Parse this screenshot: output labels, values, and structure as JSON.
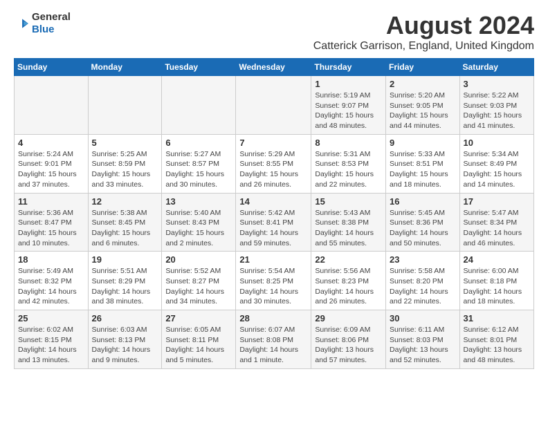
{
  "logo": {
    "text_general": "General",
    "text_blue": "Blue"
  },
  "title": "August 2024",
  "subtitle": "Catterick Garrison, England, United Kingdom",
  "weekdays": [
    "Sunday",
    "Monday",
    "Tuesday",
    "Wednesday",
    "Thursday",
    "Friday",
    "Saturday"
  ],
  "weeks": [
    [
      {
        "day": "",
        "info": ""
      },
      {
        "day": "",
        "info": ""
      },
      {
        "day": "",
        "info": ""
      },
      {
        "day": "",
        "info": ""
      },
      {
        "day": "1",
        "info": "Sunrise: 5:19 AM\nSunset: 9:07 PM\nDaylight: 15 hours\nand 48 minutes."
      },
      {
        "day": "2",
        "info": "Sunrise: 5:20 AM\nSunset: 9:05 PM\nDaylight: 15 hours\nand 44 minutes."
      },
      {
        "day": "3",
        "info": "Sunrise: 5:22 AM\nSunset: 9:03 PM\nDaylight: 15 hours\nand 41 minutes."
      }
    ],
    [
      {
        "day": "4",
        "info": "Sunrise: 5:24 AM\nSunset: 9:01 PM\nDaylight: 15 hours\nand 37 minutes."
      },
      {
        "day": "5",
        "info": "Sunrise: 5:25 AM\nSunset: 8:59 PM\nDaylight: 15 hours\nand 33 minutes."
      },
      {
        "day": "6",
        "info": "Sunrise: 5:27 AM\nSunset: 8:57 PM\nDaylight: 15 hours\nand 30 minutes."
      },
      {
        "day": "7",
        "info": "Sunrise: 5:29 AM\nSunset: 8:55 PM\nDaylight: 15 hours\nand 26 minutes."
      },
      {
        "day": "8",
        "info": "Sunrise: 5:31 AM\nSunset: 8:53 PM\nDaylight: 15 hours\nand 22 minutes."
      },
      {
        "day": "9",
        "info": "Sunrise: 5:33 AM\nSunset: 8:51 PM\nDaylight: 15 hours\nand 18 minutes."
      },
      {
        "day": "10",
        "info": "Sunrise: 5:34 AM\nSunset: 8:49 PM\nDaylight: 15 hours\nand 14 minutes."
      }
    ],
    [
      {
        "day": "11",
        "info": "Sunrise: 5:36 AM\nSunset: 8:47 PM\nDaylight: 15 hours\nand 10 minutes."
      },
      {
        "day": "12",
        "info": "Sunrise: 5:38 AM\nSunset: 8:45 PM\nDaylight: 15 hours\nand 6 minutes."
      },
      {
        "day": "13",
        "info": "Sunrise: 5:40 AM\nSunset: 8:43 PM\nDaylight: 15 hours\nand 2 minutes."
      },
      {
        "day": "14",
        "info": "Sunrise: 5:42 AM\nSunset: 8:41 PM\nDaylight: 14 hours\nand 59 minutes."
      },
      {
        "day": "15",
        "info": "Sunrise: 5:43 AM\nSunset: 8:38 PM\nDaylight: 14 hours\nand 55 minutes."
      },
      {
        "day": "16",
        "info": "Sunrise: 5:45 AM\nSunset: 8:36 PM\nDaylight: 14 hours\nand 50 minutes."
      },
      {
        "day": "17",
        "info": "Sunrise: 5:47 AM\nSunset: 8:34 PM\nDaylight: 14 hours\nand 46 minutes."
      }
    ],
    [
      {
        "day": "18",
        "info": "Sunrise: 5:49 AM\nSunset: 8:32 PM\nDaylight: 14 hours\nand 42 minutes."
      },
      {
        "day": "19",
        "info": "Sunrise: 5:51 AM\nSunset: 8:29 PM\nDaylight: 14 hours\nand 38 minutes."
      },
      {
        "day": "20",
        "info": "Sunrise: 5:52 AM\nSunset: 8:27 PM\nDaylight: 14 hours\nand 34 minutes."
      },
      {
        "day": "21",
        "info": "Sunrise: 5:54 AM\nSunset: 8:25 PM\nDaylight: 14 hours\nand 30 minutes."
      },
      {
        "day": "22",
        "info": "Sunrise: 5:56 AM\nSunset: 8:23 PM\nDaylight: 14 hours\nand 26 minutes."
      },
      {
        "day": "23",
        "info": "Sunrise: 5:58 AM\nSunset: 8:20 PM\nDaylight: 14 hours\nand 22 minutes."
      },
      {
        "day": "24",
        "info": "Sunrise: 6:00 AM\nSunset: 8:18 PM\nDaylight: 14 hours\nand 18 minutes."
      }
    ],
    [
      {
        "day": "25",
        "info": "Sunrise: 6:02 AM\nSunset: 8:15 PM\nDaylight: 14 hours\nand 13 minutes."
      },
      {
        "day": "26",
        "info": "Sunrise: 6:03 AM\nSunset: 8:13 PM\nDaylight: 14 hours\nand 9 minutes."
      },
      {
        "day": "27",
        "info": "Sunrise: 6:05 AM\nSunset: 8:11 PM\nDaylight: 14 hours\nand 5 minutes."
      },
      {
        "day": "28",
        "info": "Sunrise: 6:07 AM\nSunset: 8:08 PM\nDaylight: 14 hours\nand 1 minute."
      },
      {
        "day": "29",
        "info": "Sunrise: 6:09 AM\nSunset: 8:06 PM\nDaylight: 13 hours\nand 57 minutes."
      },
      {
        "day": "30",
        "info": "Sunrise: 6:11 AM\nSunset: 8:03 PM\nDaylight: 13 hours\nand 52 minutes."
      },
      {
        "day": "31",
        "info": "Sunrise: 6:12 AM\nSunset: 8:01 PM\nDaylight: 13 hours\nand 48 minutes."
      }
    ]
  ]
}
